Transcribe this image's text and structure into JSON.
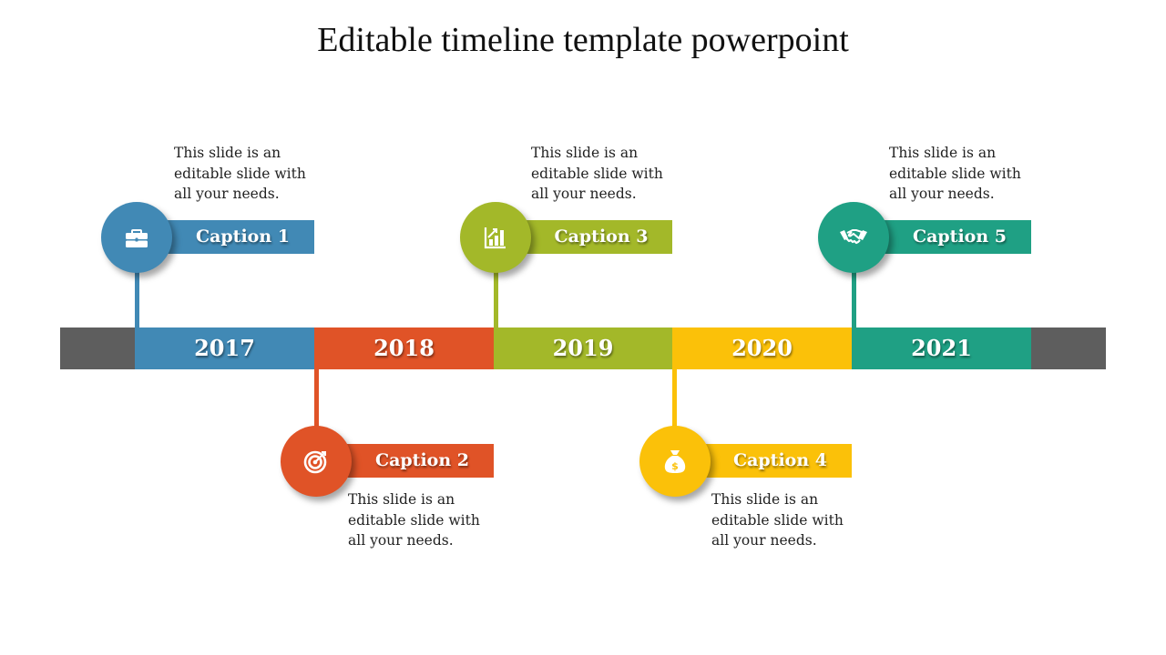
{
  "title": "Editable timeline template powerpoint",
  "colors": {
    "blue": "#4189b5",
    "orange": "#e05327",
    "green": "#a3b829",
    "yellow": "#fbc109",
    "teal": "#1fa084",
    "gray": "#5e5e5e"
  },
  "timeline": {
    "years": [
      "2017",
      "2018",
      "2019",
      "2020",
      "2021"
    ]
  },
  "milestones": [
    {
      "caption": "Caption 1",
      "icon": "briefcase-icon",
      "position": "above",
      "description": "This slide is an editable slide with all your needs."
    },
    {
      "caption": "Caption 2",
      "icon": "target-icon",
      "position": "below",
      "description": "This slide is an editable slide with all your needs."
    },
    {
      "caption": "Caption 3",
      "icon": "growth-chart-icon",
      "position": "above",
      "description": "This slide is an editable slide with all your needs."
    },
    {
      "caption": "Caption 4",
      "icon": "money-bag-icon",
      "position": "below",
      "description": "This slide is an editable slide with all your needs."
    },
    {
      "caption": "Caption 5",
      "icon": "handshake-icon",
      "position": "above",
      "description": "This slide is an editable slide with all your needs."
    }
  ]
}
